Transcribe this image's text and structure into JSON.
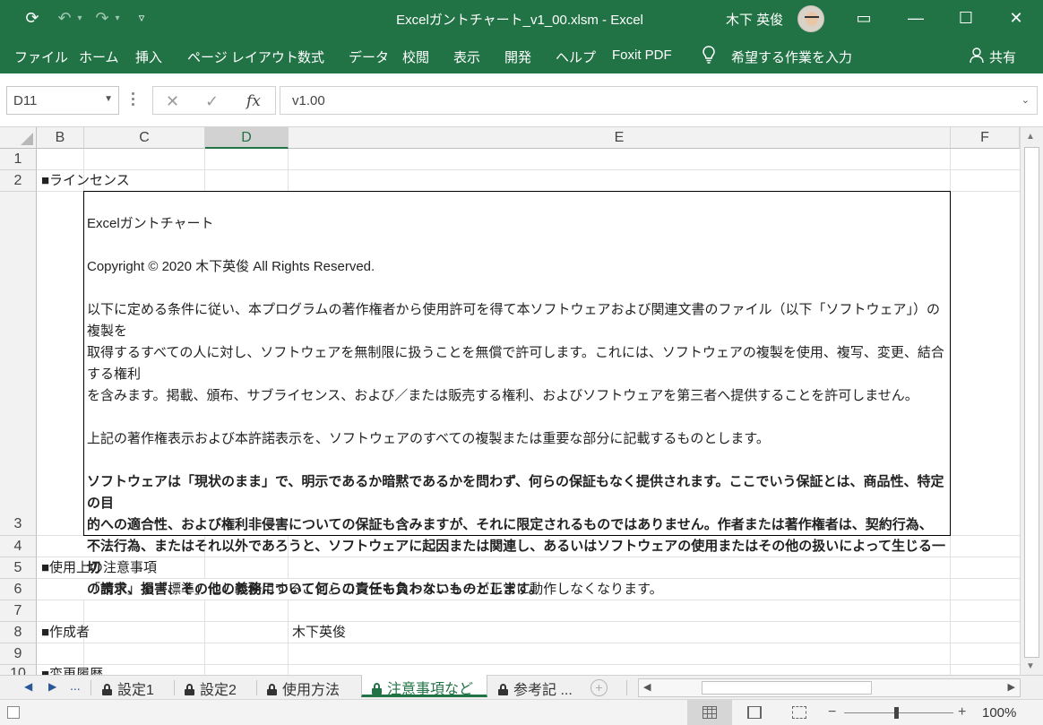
{
  "titlebar": {
    "file_title": "Excelガントチャート_v1_00.xlsm  -  Excel",
    "user_name": "木下 英俊",
    "qat": {
      "save": "⟳",
      "undo": "↶",
      "undo_drop": "▾",
      "redo": "↷",
      "redo_drop": "▾",
      "customize": "▿"
    },
    "buttons": {
      "ribbon_display": "▭",
      "minimize": "—",
      "maximize": "☐",
      "close": "✕"
    }
  },
  "ribbon": {
    "tabs": [
      "ファイル",
      "ホーム",
      "挿入",
      "ページ レイアウト",
      "数式",
      "データ",
      "校閲",
      "表示",
      "開発",
      "ヘルプ",
      "Foxit PDF"
    ],
    "tell_me": "希望する作業を入力",
    "share": "共有"
  },
  "formula_bar": {
    "name_box": "D11",
    "cancel": "✕",
    "enter": "✓",
    "fx": "fx",
    "formula": "v1.00"
  },
  "grid": {
    "columns": [
      "B",
      "C",
      "D",
      "E",
      "F"
    ],
    "selected_column": "D",
    "rows": [
      "1",
      "2",
      "3",
      "4",
      "5",
      "6",
      "7",
      "8",
      "9",
      "10"
    ],
    "cells": {
      "b2": "■ラインセンス",
      "b5": "■使用上の注意事項",
      "c6": "「表示」を「標準」にして使用すること。コンテキストメニューが正常に動作しなくなります。",
      "b8": "■作成者",
      "d8": "木下英俊",
      "b10": "■変更履歴"
    },
    "license": {
      "title": "Excelガントチャート",
      "copyright": "Copyright © 2020  木下英俊  All Rights Reserved.",
      "para1_l1": "以下に定める条件に従い、本プログラムの著作権者から使用許可を得て本ソフトウェアおよび関連文書のファイル（以下「ソフトウェア」）の複製を",
      "para1_l2": "取得するすべての人に対し、ソフトウェアを無制限に扱うことを無償で許可します。これには、ソフトウェアの複製を使用、複写、変更、結合する権利",
      "para1_l3": "を含みます。掲載、頒布、サブライセンス、および／または販売する権利、およびソフトウェアを第三者へ提供することを許可しません。",
      "para2": "上記の著作権表示および本許諾表示を、ソフトウェアのすべての複製または重要な部分に記載するものとします。",
      "para3_l1": "ソフトウェアは「現状のまま」で、明示であるか暗黙であるかを問わず、何らの保証もなく提供されます。ここでいう保証とは、商品性、特定の目",
      "para3_l2": "的への適合性、および権利非侵害についての保証も含みますが、それに限定されるものではありません。作者または著作権者は、契約行為、",
      "para3_l3": "不法行為、またはそれ以外であろうと、ソフトウェアに起因または関連し、あるいはソフトウェアの使用またはその他の扱いによって生じる一切",
      "para3_l4": "の請求、損害、その他の義務について何らの責任も負わないものとします。"
    }
  },
  "sheet_tabs": {
    "nav_prev": "◀",
    "nav_next": "▶",
    "nav_more": "...",
    "tabs": [
      "設定1",
      "設定2",
      "使用方法",
      "注意事項など",
      "参考記 ..."
    ],
    "active_index": 3,
    "add": "+"
  },
  "status_bar": {
    "zoom_minus": "−",
    "zoom_plus": "+",
    "zoom": "100%"
  },
  "colors": {
    "brand": "#217346",
    "header_bg": "#f2f2f2",
    "gridline": "#e1e1e1"
  }
}
